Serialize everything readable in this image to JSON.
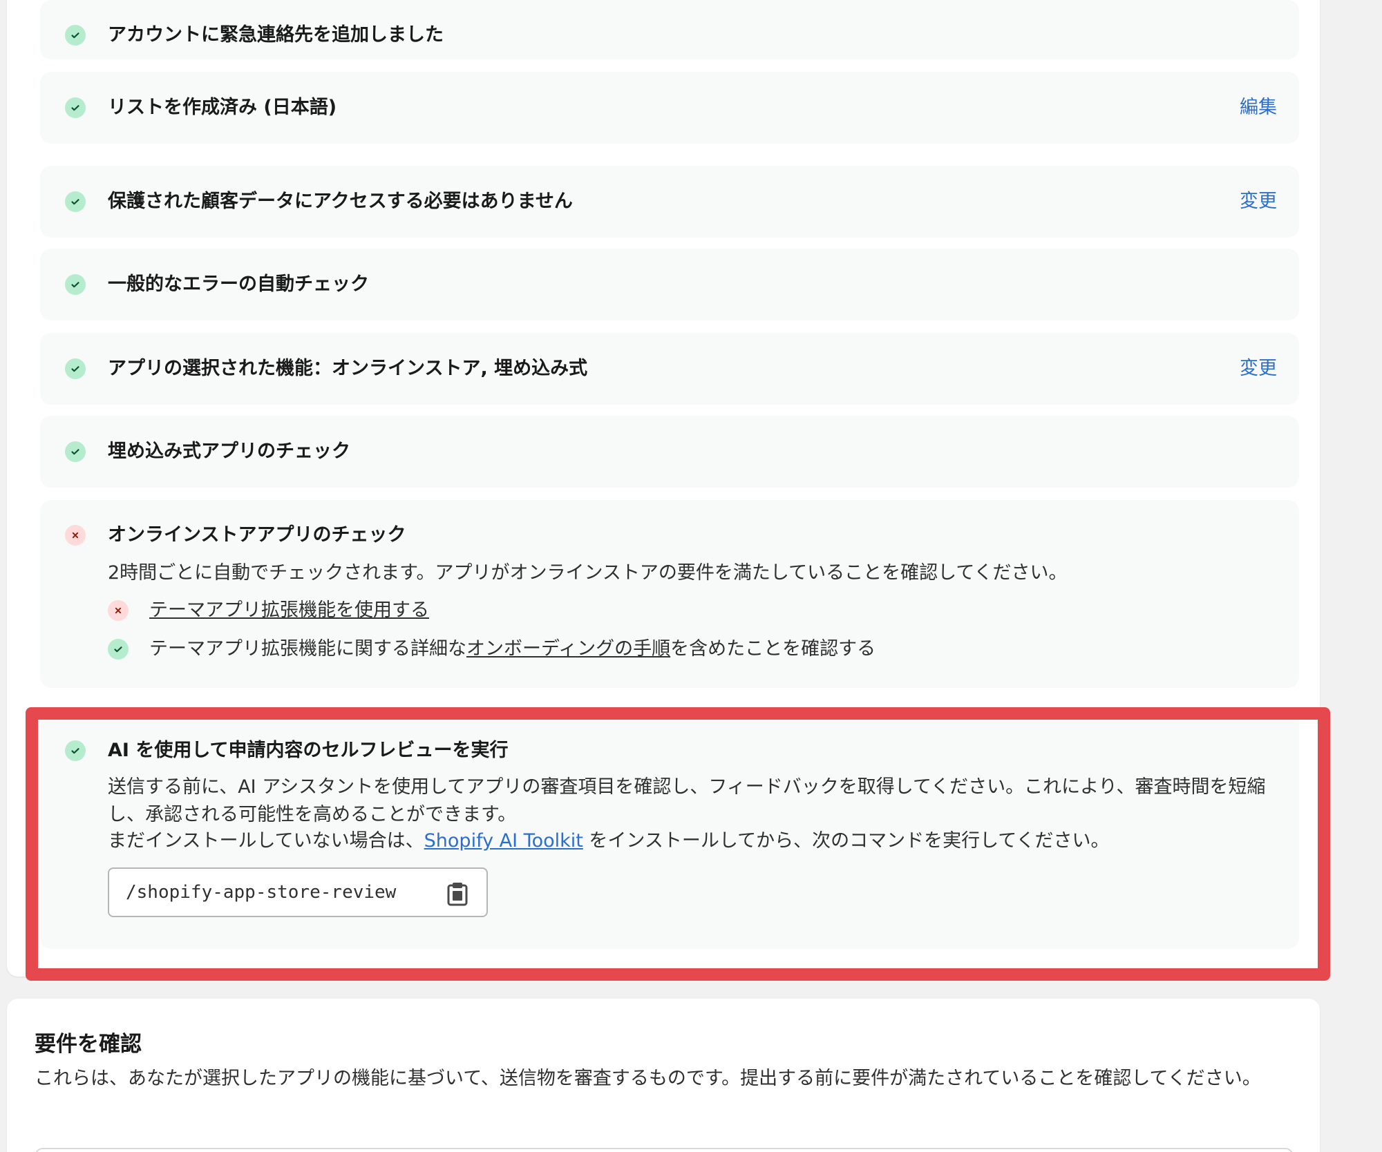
{
  "checks": [
    {
      "status": "ok",
      "title": "アカウントに緊急連絡先を追加しました"
    },
    {
      "status": "ok",
      "title": "リストを作成済み (日本語)",
      "action": "編集"
    },
    {
      "status": "ok",
      "title": "保護された顧客データにアクセスする必要はありません",
      "action": "変更"
    },
    {
      "status": "ok",
      "title": "一般的なエラーの自動チェック"
    },
    {
      "status": "ok",
      "title": "アプリの選択された機能：オンラインストア, 埋め込み式",
      "action": "変更"
    },
    {
      "status": "ok",
      "title": "埋め込み式アプリのチェック"
    }
  ],
  "online_store": {
    "status": "error",
    "title": "オンラインストアアプリのチェック",
    "description": "2時間ごとに自動でチェックされます。アプリがオンラインストアの要件を満たしていることを確認してください。",
    "items": [
      {
        "status": "error",
        "link_text": "テーマアプリ拡張機能を使用する"
      },
      {
        "status": "ok",
        "text_before": "テーマアプリ拡張機能に関する詳細な",
        "link_text": "オンボーディングの手順",
        "text_after": "を含めたことを確認する"
      }
    ]
  },
  "ai_review": {
    "status": "ok",
    "title": "AI を使用して申請内容のセルフレビューを実行",
    "description": "送信する前に、AI アシスタントを使用してアプリの審査項目を確認し、フィードバックを取得してください。これにより、審査時間を短縮し、承認される可能性を高めることができます。",
    "install_before": "まだインストールしていない場合は、",
    "install_link": "Shopify AI Toolkit",
    "install_after": " をインストールしてから、次のコマンドを実行してください。",
    "command": "/shopify-app-store-review",
    "copy_icon": "clipboard-icon"
  },
  "requirements": {
    "heading": "要件を確認",
    "description": "これらは、あなたが選択したアプリの機能に基づいて、送信物を審査するものです。提出する前に要件が満たされていることを確認してください。"
  },
  "colors": {
    "ok_bg": "#b5ecce",
    "ok_fg": "#0c5132",
    "error_bg": "#fedada",
    "error_fg": "#8e1f0b",
    "link": "#2c6ecb",
    "highlight": "#e5484d"
  }
}
